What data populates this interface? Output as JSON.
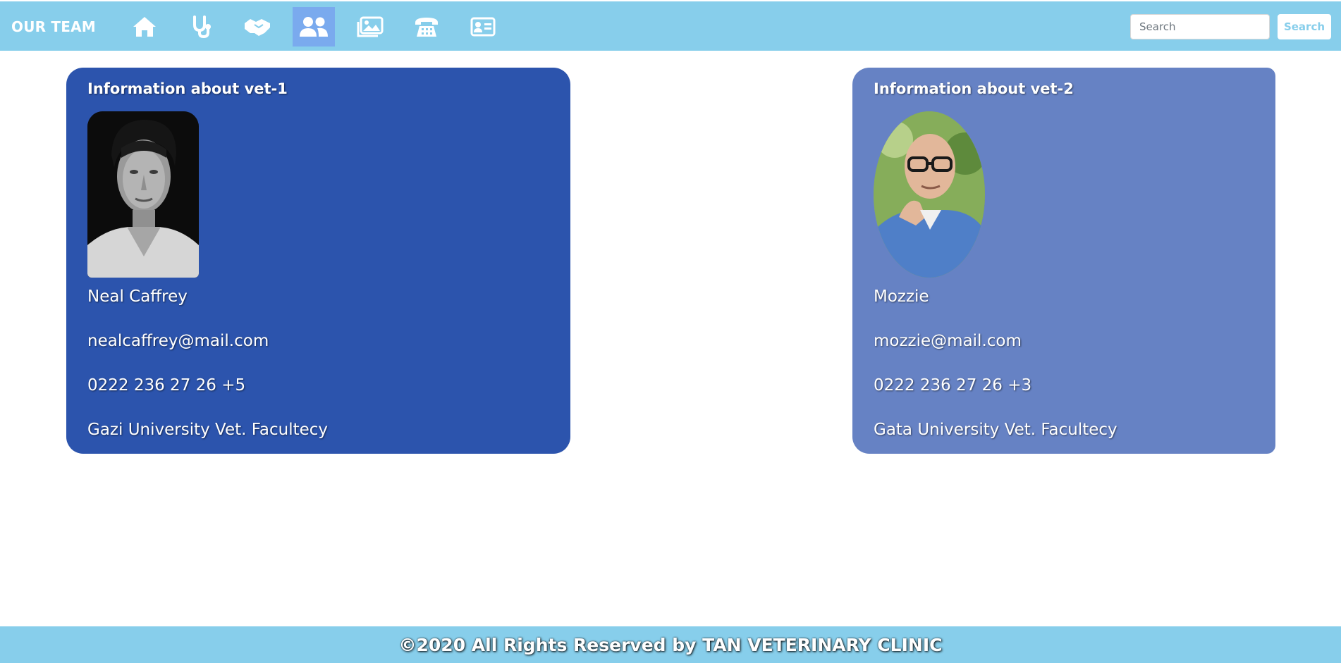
{
  "navbar": {
    "brand": "OUR TEAM",
    "items": [
      {
        "icon": "home-icon",
        "active": false
      },
      {
        "icon": "stethoscope-icon",
        "active": false
      },
      {
        "icon": "handshake-icon",
        "active": false
      },
      {
        "icon": "users-icon",
        "active": true
      },
      {
        "icon": "gallery-icon",
        "active": false
      },
      {
        "icon": "phone-icon",
        "active": false
      },
      {
        "icon": "contact-card-icon",
        "active": false
      }
    ],
    "search_placeholder": "Search",
    "search_button": "Search"
  },
  "vets": [
    {
      "title": "Information about vet-1",
      "name": "Neal Caffrey",
      "email": "nealcaffrey@mail.com",
      "phone": "0222 236 27 26 +5",
      "school": "Gazi University Vet. Facultecy",
      "card_color": "#2c54ad"
    },
    {
      "title": "Information about vet-2",
      "name": "Mozzie",
      "email": "mozzie@mail.com",
      "phone": "0222 236 27 26 +3",
      "school": "Gata University Vet. Facultecy",
      "card_color": "#6682c4"
    }
  ],
  "footer": {
    "text": "©2020 All Rights Reserved by TAN VETERINARY CLINIC"
  },
  "colors": {
    "navbar": "#87ceeb",
    "active_nav": "#7aaaee",
    "text": "#ffffff"
  }
}
